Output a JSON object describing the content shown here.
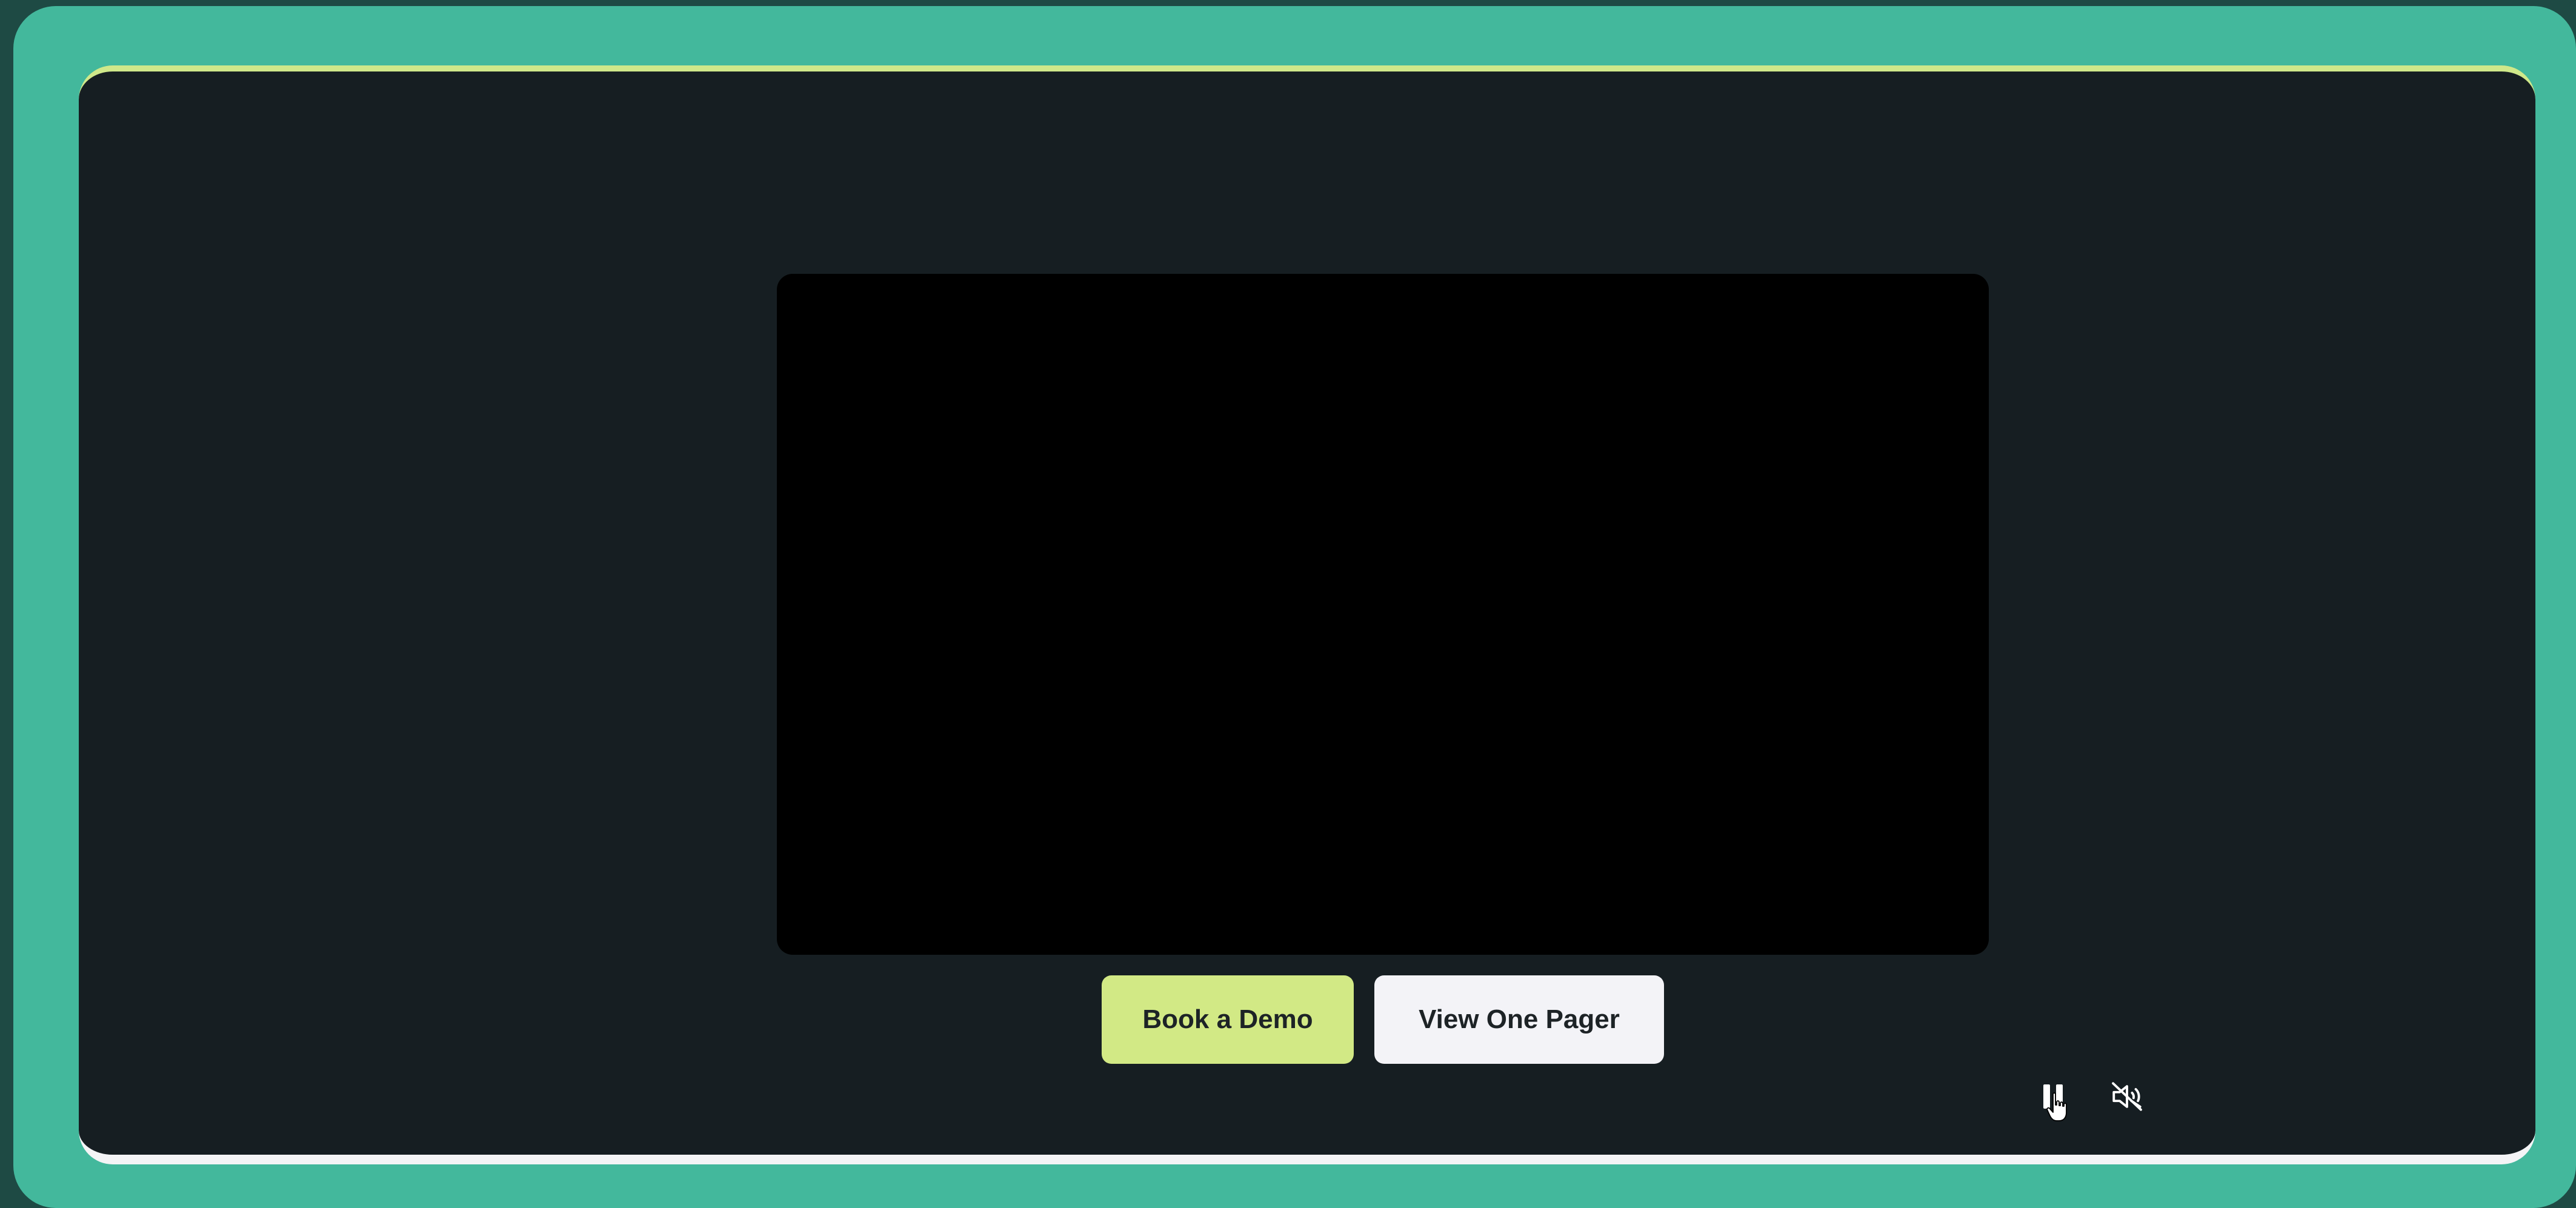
{
  "colors": {
    "frame": "#43b89c",
    "panel": "#161e22",
    "accent": "#d2e985",
    "video_bg": "#000000",
    "secondary_button": "#f3f3f7"
  },
  "video": {
    "controls": {
      "play_pause_icon": "pause-icon",
      "volume_icon": "muted-speaker-icon",
      "cursor_icon": "hand-pointer-icon"
    }
  },
  "cta": {
    "primary_label": "Book a Demo",
    "secondary_label": "View One Pager"
  }
}
